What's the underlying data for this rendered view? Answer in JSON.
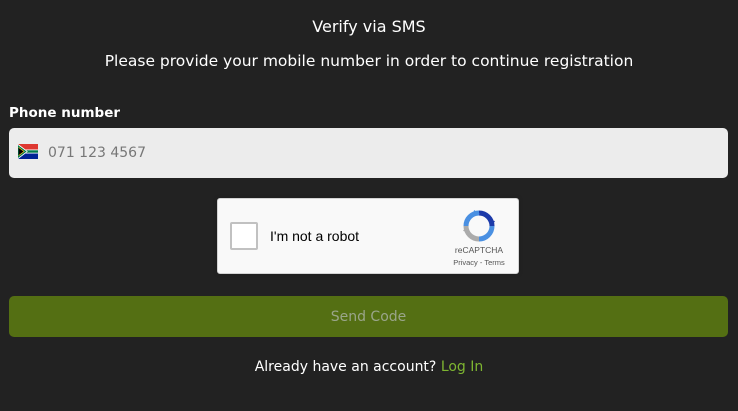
{
  "header": {
    "title": "Verify via SMS",
    "subtitle": "Please provide your mobile number in order to continue registration"
  },
  "phone": {
    "label": "Phone number",
    "placeholder": "071 123 4567",
    "country_flag": "south-africa-flag"
  },
  "captcha": {
    "checkbox_label": "I'm not a robot",
    "brand": "reCAPTCHA",
    "privacy_link": "Privacy",
    "separator": " - ",
    "terms_link": "Terms",
    "logo_icon": "recaptcha-logo-icon",
    "checked": false
  },
  "actions": {
    "send_code_label": "Send Code"
  },
  "footer": {
    "prompt": "Already have an account?",
    "login_label": "Log In"
  },
  "colors": {
    "background": "#222222",
    "button": "#546f13",
    "button_text": "#9aa58a",
    "link": "#7eb531",
    "input_bg": "#ececec"
  }
}
